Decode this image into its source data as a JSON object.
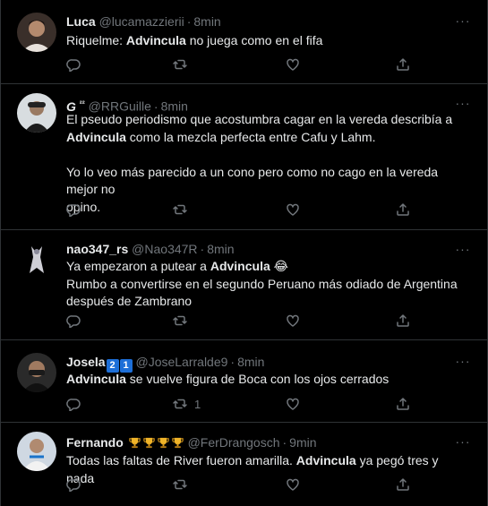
{
  "tweets": [
    {
      "name": "Luca",
      "handle": "@lucamazzierii",
      "time": "8min",
      "text_lines": [
        [
          {
            "t": "Riquelme: ",
            "b": false
          },
          {
            "t": "Advincula",
            "b": true
          },
          {
            "t": " no juega como en el fifa",
            "b": false
          }
        ]
      ],
      "reply_count": "",
      "retweet_count": "",
      "like_count": ""
    },
    {
      "name": "G",
      "name_suffix": "²²",
      "handle": "@RRGuille",
      "time": "8min",
      "text_lines": [
        [
          {
            "t": "El pseudo periodismo que acostumbra cagar en la vereda describía a",
            "b": false
          }
        ],
        [
          {
            "t": "Advincula",
            "b": true
          },
          {
            "t": " como la mezcla perfecta entre Cafu y Lahm.",
            "b": false
          }
        ],
        [],
        [
          {
            "t": "Yo lo veo más parecido a un cono pero como no cago en la vereda mejor no",
            "b": false
          }
        ],
        [
          {
            "t": "opino.",
            "b": false
          }
        ]
      ],
      "reply_count": "",
      "retweet_count": "",
      "like_count": ""
    },
    {
      "name": "nao347_rs",
      "handle": "@Nao347R",
      "time": "8min",
      "text_lines": [
        [
          {
            "t": "Ya empezaron a putear a ",
            "b": false
          },
          {
            "t": "Advincula",
            "b": true
          },
          {
            "t": " 😂",
            "b": false
          }
        ],
        [
          {
            "t": "Rumbo a convertirse en el segundo Peruano más odiado de Argentina",
            "b": false
          }
        ],
        [
          {
            "t": "después de Zambrano",
            "b": false
          }
        ]
      ],
      "reply_count": "",
      "retweet_count": "",
      "like_count": ""
    },
    {
      "name": "Josela",
      "badges": [
        "2",
        "1"
      ],
      "handle": "@JoseLarralde9",
      "time": "8min",
      "text_lines": [
        [
          {
            "t": "Advincula",
            "b": true
          },
          {
            "t": " se vuelve figura de Boca con los ojos cerrados",
            "b": false
          }
        ]
      ],
      "reply_count": "",
      "retweet_count": "1",
      "like_count": ""
    },
    {
      "name": "Fernando",
      "trophies": 4,
      "handle": "@FerDrangosch",
      "time": "9min",
      "text_lines": [
        [
          {
            "t": "Todas las faltas de River fueron amarilla. ",
            "b": false
          },
          {
            "t": "Advincula",
            "b": true
          },
          {
            "t": " ya pegó tres y nada",
            "b": false
          }
        ]
      ],
      "reply_count": "",
      "retweet_count": "",
      "like_count": ""
    }
  ],
  "icons": {
    "reply": "reply-icon",
    "retweet": "retweet-icon",
    "like": "like-icon",
    "share": "share-icon",
    "more": "more-icon"
  },
  "colors": {
    "background": "#000000",
    "divider": "#2f3336",
    "text": "#e7e9ea",
    "muted": "#71767b",
    "badge": "#1d6fd8"
  }
}
